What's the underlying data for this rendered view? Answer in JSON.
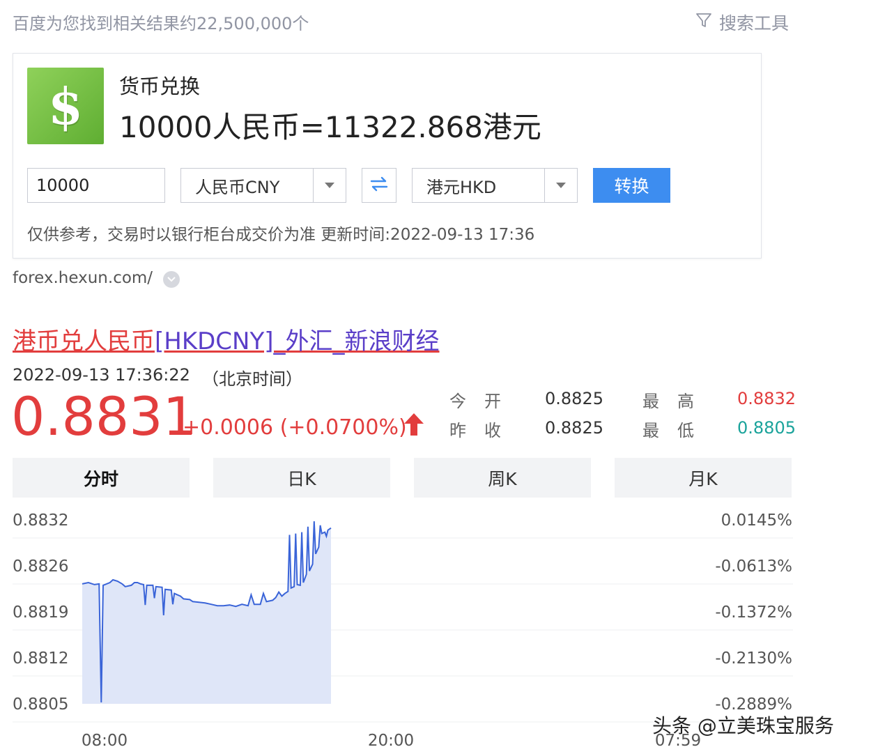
{
  "header": {
    "result_count": "百度为您找到相关结果约22,500,000个",
    "search_tools": "搜索工具"
  },
  "converter": {
    "title": "货币兑换",
    "result": "10000人民币=11322.868港元",
    "amount_value": "10000",
    "from_currency": "人民币CNY",
    "to_currency": "港元HKD",
    "convert_label": "转换",
    "disclaimer": "仅供参考，交易时以银行柜台成交价为准 更新时间:2022-09-13 17:36",
    "source_url": "forex.hexun.com/"
  },
  "result": {
    "link_red": "港币兑人民币",
    "link_rest": "[HKDCNY]_外汇_新浪财经",
    "timestamp": "2022-09-13 17:36:22",
    "timezone": "（北京时间）",
    "price": "0.8831",
    "change": "+0.0006 (+0.0700%)",
    "stats": {
      "open_label": "今开",
      "open_value": "0.8825",
      "prev_close_label": "昨收",
      "prev_close_value": "0.8825",
      "high_label": "最高",
      "high_value": "0.8832",
      "low_label": "最低",
      "low_value": "0.8805"
    },
    "tabs": [
      "分时",
      "日K",
      "周K",
      "月K"
    ]
  },
  "colors": {
    "up": "#e23d3d",
    "down": "#1aa39b",
    "line": "#3a64d8",
    "link_visited": "#5a3ec8",
    "button": "#3d8df0"
  },
  "chart_data": {
    "type": "area",
    "y_tick_labels": [
      "0.8832",
      "0.8826",
      "0.8819",
      "0.8812",
      "0.8805"
    ],
    "y_right_tick_labels": [
      "0.0145%",
      "-0.0613%",
      "-0.1372%",
      "-0.2130%",
      "-0.2889%"
    ],
    "x_tick_labels": [
      "08:00",
      "20:00",
      "07:59"
    ],
    "ylim": [
      0.8805,
      0.8832
    ],
    "grid": true,
    "points": [
      [
        0.0,
        0.88226
      ],
      [
        0.02,
        0.88228
      ],
      [
        0.04,
        0.88225
      ],
      [
        0.055,
        0.88226
      ],
      [
        0.062,
        0.88052
      ],
      [
        0.068,
        0.88224
      ],
      [
        0.09,
        0.88228
      ],
      [
        0.1,
        0.88232
      ],
      [
        0.115,
        0.8823
      ],
      [
        0.13,
        0.88226
      ],
      [
        0.14,
        0.88222
      ],
      [
        0.16,
        0.88224
      ],
      [
        0.17,
        0.88228
      ],
      [
        0.18,
        0.88228
      ],
      [
        0.19,
        0.88226
      ],
      [
        0.2,
        0.88225
      ],
      [
        0.205,
        0.88195
      ],
      [
        0.21,
        0.88224
      ],
      [
        0.23,
        0.88224
      ],
      [
        0.235,
        0.88205
      ],
      [
        0.24,
        0.88222
      ],
      [
        0.26,
        0.88221
      ],
      [
        0.265,
        0.8818
      ],
      [
        0.27,
        0.88218
      ],
      [
        0.29,
        0.88217
      ],
      [
        0.295,
        0.88196
      ],
      [
        0.3,
        0.88212
      ],
      [
        0.32,
        0.88208
      ],
      [
        0.33,
        0.88204
      ],
      [
        0.35,
        0.88203
      ],
      [
        0.36,
        0.882
      ],
      [
        0.38,
        0.88199
      ],
      [
        0.4,
        0.88198
      ],
      [
        0.42,
        0.88196
      ],
      [
        0.44,
        0.88194
      ],
      [
        0.46,
        0.88194
      ],
      [
        0.48,
        0.88195
      ],
      [
        0.5,
        0.88193
      ],
      [
        0.52,
        0.88196
      ],
      [
        0.54,
        0.88194
      ],
      [
        0.55,
        0.8821
      ],
      [
        0.56,
        0.88196
      ],
      [
        0.58,
        0.88196
      ],
      [
        0.59,
        0.88212
      ],
      [
        0.6,
        0.882
      ],
      [
        0.62,
        0.88202
      ],
      [
        0.63,
        0.88206
      ],
      [
        0.64,
        0.88214
      ],
      [
        0.65,
        0.88208
      ],
      [
        0.66,
        0.88212
      ],
      [
        0.67,
        0.88215
      ],
      [
        0.675,
        0.88298
      ],
      [
        0.68,
        0.8822
      ],
      [
        0.69,
        0.88222
      ],
      [
        0.695,
        0.883
      ],
      [
        0.7,
        0.88225
      ],
      [
        0.71,
        0.88224
      ],
      [
        0.715,
        0.88302
      ],
      [
        0.72,
        0.88228
      ],
      [
        0.73,
        0.8824
      ],
      [
        0.735,
        0.8831
      ],
      [
        0.74,
        0.88245
      ],
      [
        0.75,
        0.88255
      ],
      [
        0.755,
        0.88318
      ],
      [
        0.76,
        0.8827
      ],
      [
        0.77,
        0.8828
      ],
      [
        0.775,
        0.88312
      ],
      [
        0.78,
        0.883
      ],
      [
        0.79,
        0.88302
      ],
      [
        0.795,
        0.88296
      ],
      [
        0.8,
        0.88305
      ],
      [
        0.81,
        0.88308
      ]
    ]
  },
  "watermark": "头条 @立美珠宝服务"
}
